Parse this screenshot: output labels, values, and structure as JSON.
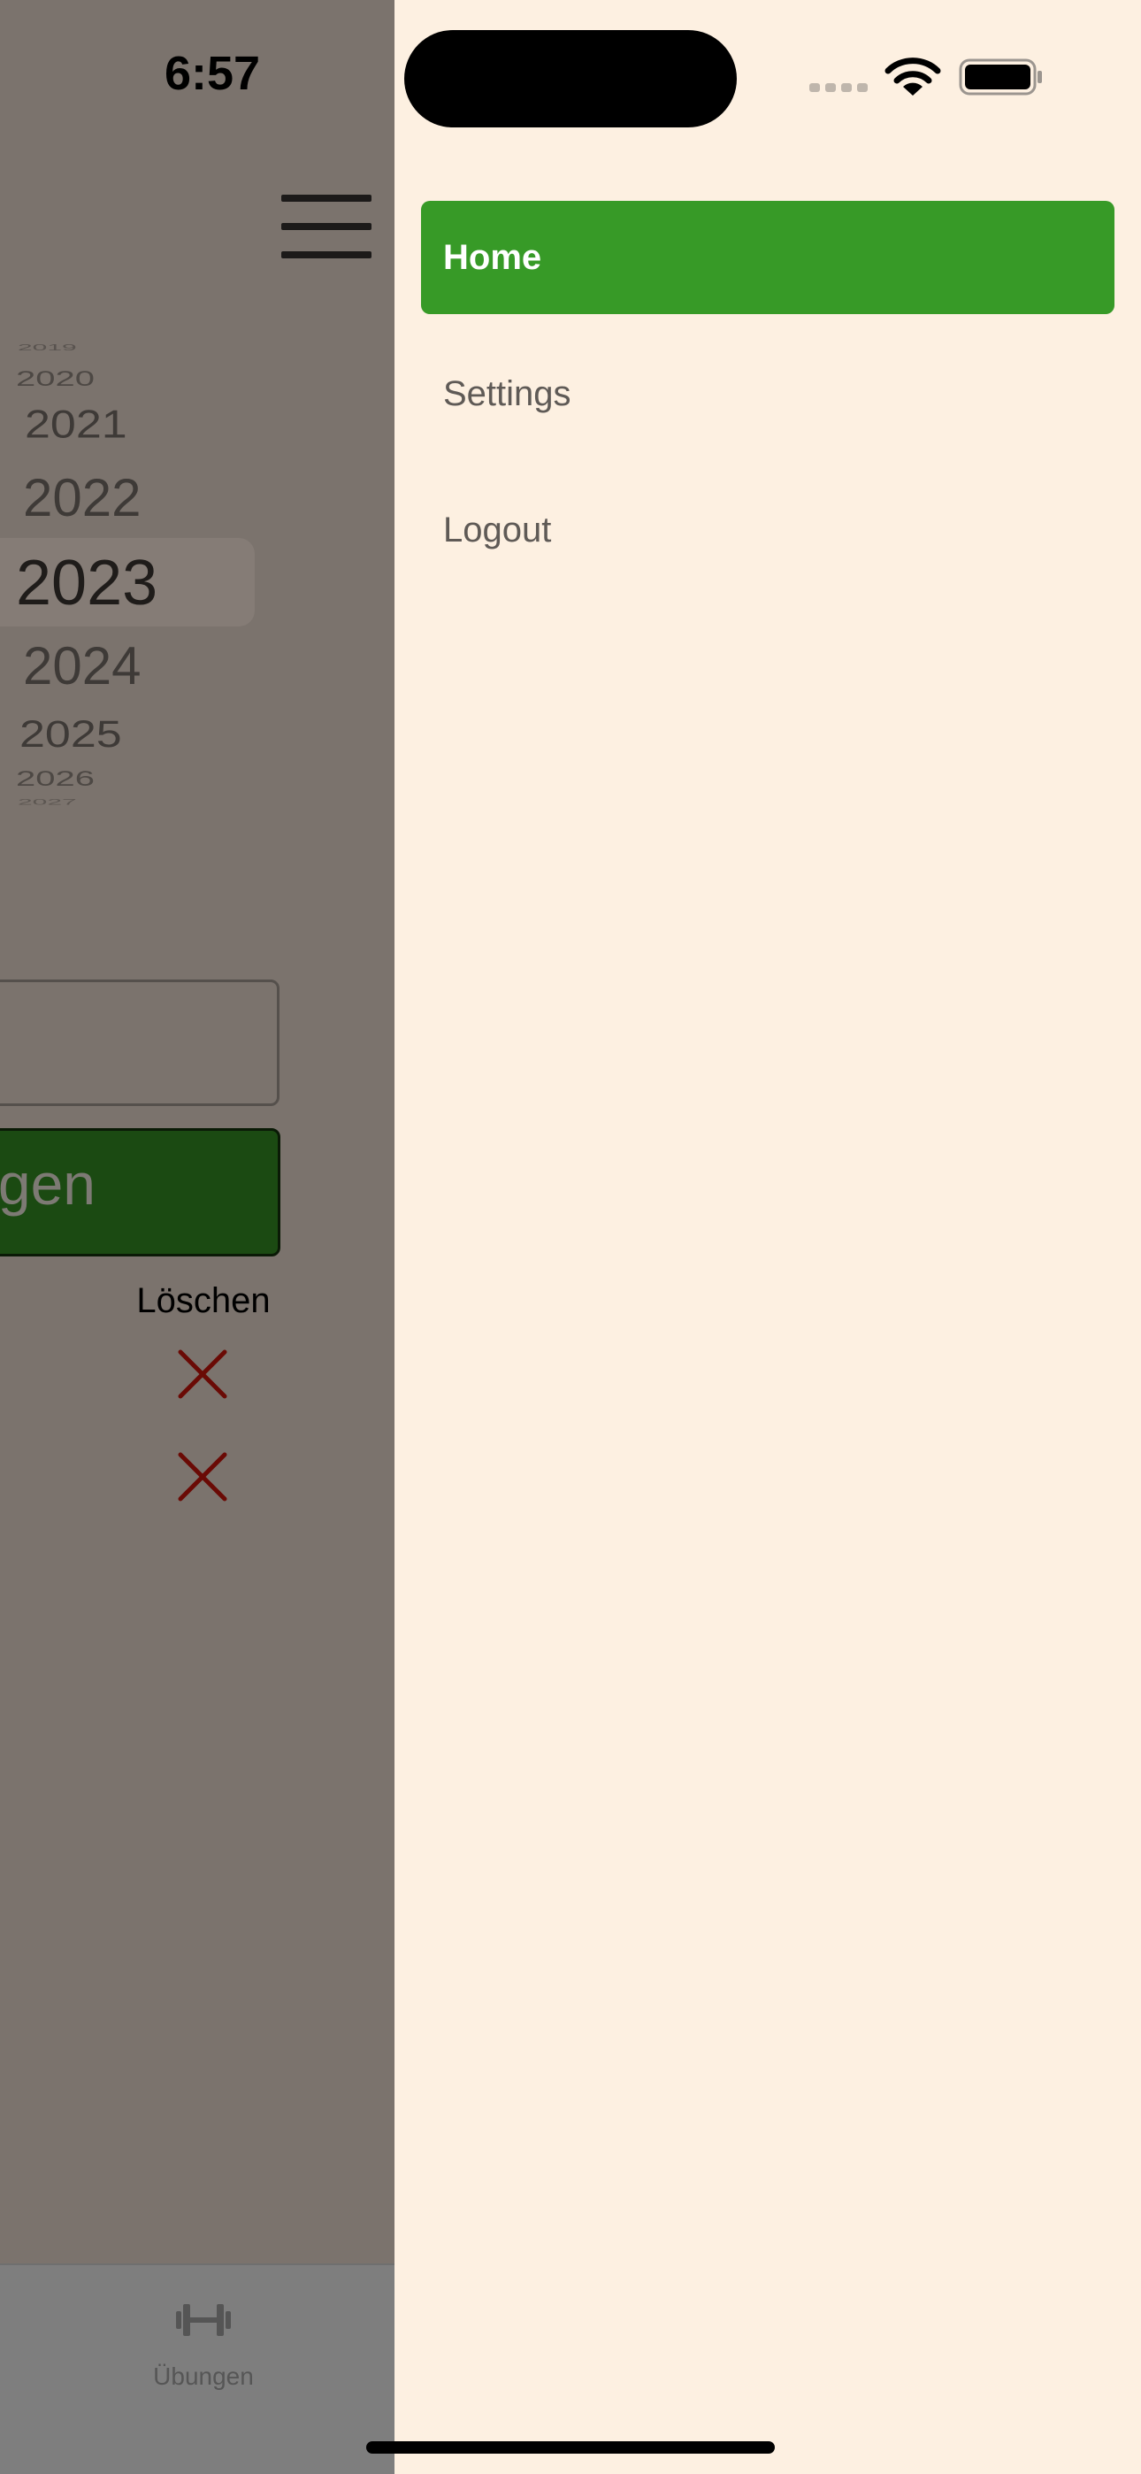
{
  "status_bar": {
    "time": "6:57"
  },
  "year_picker": {
    "years": [
      "2019",
      "2020",
      "2021",
      "2022",
      "2023",
      "2024",
      "2025",
      "2026",
      "2027"
    ],
    "selected": "2023"
  },
  "form": {
    "input_value": "",
    "add_button_label": "Hinzufügen",
    "delete_column_header": "Löschen"
  },
  "tab_bar": {
    "tabs": [
      {
        "label": "Übungen",
        "icon": "dumbbell-icon"
      }
    ]
  },
  "side_menu": {
    "items": [
      {
        "label": "Home",
        "active": true
      },
      {
        "label": "Settings",
        "active": false
      },
      {
        "label": "Logout",
        "active": false
      }
    ]
  },
  "colors": {
    "menu_background": "#fdf0e1",
    "active_item": "#379a27",
    "dimmed_overlay": "#7b736d",
    "delete_icon": "#6a0a05",
    "add_button": "#1b4a12"
  }
}
